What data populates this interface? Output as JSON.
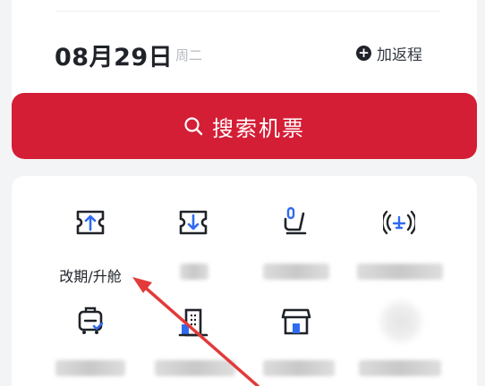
{
  "date": {
    "main": "08月29日",
    "weekday": "周二"
  },
  "return_trip": {
    "label": "加返程",
    "icon": "plus-circle-icon"
  },
  "search": {
    "label": "搜索机票",
    "icon": "search-icon"
  },
  "services": [
    {
      "label": "改期/升舱",
      "icon": "ticket-upgrade-icon"
    },
    {
      "label": "",
      "icon": "ticket-download-icon"
    },
    {
      "label": "",
      "icon": "seat-icon"
    },
    {
      "label": "",
      "icon": "flight-signal-icon"
    },
    {
      "label": "",
      "icon": "luggage-check-icon"
    },
    {
      "label": "",
      "icon": "building-icon"
    },
    {
      "label": "",
      "icon": "store-icon"
    },
    {
      "label": "",
      "icon": "blurred-icon"
    }
  ],
  "colors": {
    "brand_red": "#d41e35",
    "icon_blue": "#2f6bf2",
    "annotation_arrow": "#e33a3a"
  }
}
